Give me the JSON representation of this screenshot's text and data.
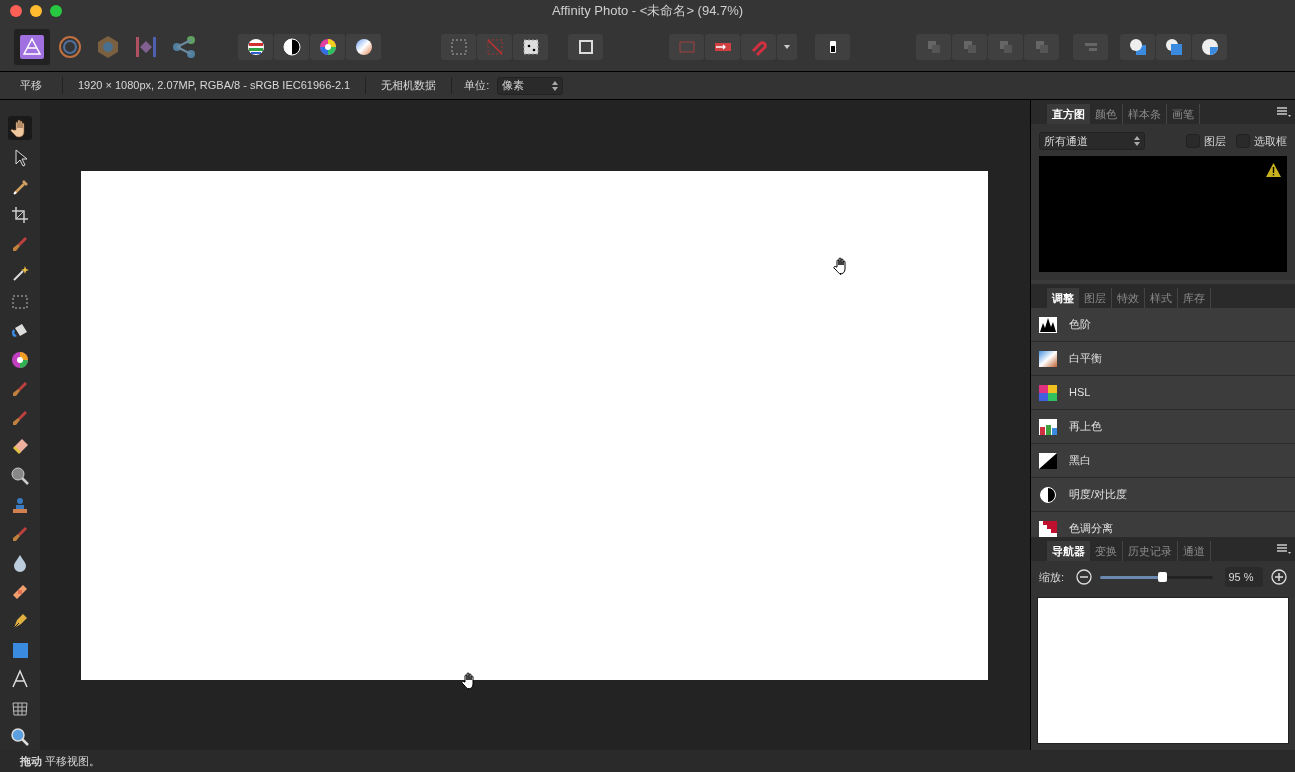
{
  "window": {
    "title": "Affinity Photo - <未命名> (94.7%)"
  },
  "toolbar": {
    "personas": [
      {
        "kind": "photo",
        "selected": true
      },
      {
        "kind": "liquify",
        "selected": false
      },
      {
        "kind": "develop",
        "selected": false
      },
      {
        "kind": "tonemap",
        "selected": false
      },
      {
        "kind": "export",
        "selected": false
      }
    ],
    "groups": [
      [
        {
          "kind": "levels"
        },
        {
          "kind": "bw"
        },
        {
          "kind": "wheel"
        },
        {
          "kind": "balance"
        }
      ],
      [
        {
          "kind": "marquee"
        },
        {
          "kind": "deselect"
        },
        {
          "kind": "invert"
        }
      ],
      [
        {
          "kind": "quickmask"
        }
      ],
      [
        {
          "kind": "snap-a"
        },
        {
          "kind": "snap-b"
        },
        {
          "kind": "magnet"
        },
        {
          "kind": "caret"
        }
      ],
      [
        {
          "kind": "brush"
        }
      ],
      [
        {
          "kind": "arrange"
        },
        {
          "kind": "arrange"
        },
        {
          "kind": "arrange"
        },
        {
          "kind": "arrange"
        }
      ],
      [
        {
          "kind": "align"
        }
      ],
      [
        {
          "kind": "bool-a"
        },
        {
          "kind": "bool-b"
        },
        {
          "kind": "bool-c"
        }
      ]
    ]
  },
  "context_bar": {
    "tool": "平移",
    "info": "1920 × 1080px, 2.07MP, RGBA/8 - sRGB IEC61966-2.1",
    "camera": "无相机数据",
    "unit_label": "单位:",
    "unit_value": "像素"
  },
  "tools": [
    {
      "kind": "hand",
      "selected": true
    },
    {
      "kind": "arrow",
      "selected": false
    },
    {
      "kind": "picker",
      "selected": false
    },
    {
      "kind": "crop",
      "selected": false
    },
    {
      "kind": "brush",
      "selected": false
    },
    {
      "kind": "wand",
      "selected": false
    },
    {
      "kind": "marquee",
      "selected": false
    },
    {
      "kind": "fill",
      "selected": false
    },
    {
      "kind": "wheel",
      "selected": false
    },
    {
      "kind": "brush",
      "selected": false
    },
    {
      "kind": "brush",
      "selected": false
    },
    {
      "kind": "eraser",
      "selected": false
    },
    {
      "kind": "lens",
      "selected": false
    },
    {
      "kind": "stamp",
      "selected": false
    },
    {
      "kind": "brush",
      "selected": false
    },
    {
      "kind": "drop",
      "selected": false
    },
    {
      "kind": "bandage",
      "selected": false
    },
    {
      "kind": "pen",
      "selected": false
    },
    {
      "kind": "square",
      "selected": false
    },
    {
      "kind": "text",
      "selected": false
    },
    {
      "kind": "mesh",
      "selected": false
    },
    {
      "kind": "zoom",
      "selected": false
    }
  ],
  "histogram_panel": {
    "tabs": [
      {
        "label": "直方图",
        "selected": true
      },
      {
        "label": "颜色",
        "selected": false
      },
      {
        "label": "样本条",
        "selected": false
      },
      {
        "label": "画笔",
        "selected": false
      }
    ],
    "channel_select": "所有通道",
    "checkboxes": [
      {
        "label": "图层",
        "checked": false
      },
      {
        "label": "选取框",
        "checked": false
      }
    ]
  },
  "adjustments_panel": {
    "tabs": [
      {
        "label": "调整",
        "selected": true
      },
      {
        "label": "图层",
        "selected": false
      },
      {
        "label": "特效",
        "selected": false
      },
      {
        "label": "样式",
        "selected": false
      },
      {
        "label": "库存",
        "selected": false
      }
    ],
    "items": [
      {
        "kind": "levels",
        "label": "色阶"
      },
      {
        "kind": "balance",
        "label": "白平衡"
      },
      {
        "kind": "hsl",
        "label": "HSL"
      },
      {
        "kind": "recolor",
        "label": "再上色"
      },
      {
        "kind": "bw",
        "label": "黑白"
      },
      {
        "kind": "contrast",
        "label": "明度/对比度"
      },
      {
        "kind": "posterize",
        "label": "色调分离"
      }
    ]
  },
  "navigator_panel": {
    "tabs": [
      {
        "label": "导航器",
        "selected": true
      },
      {
        "label": "变换",
        "selected": false
      },
      {
        "label": "历史记录",
        "selected": false
      },
      {
        "label": "通道",
        "selected": false
      }
    ],
    "zoom_label": "缩放:",
    "level": 0.55,
    "zoom_value": "95 %"
  },
  "status_bar": {
    "text": "**拖动** 平移视图。"
  }
}
